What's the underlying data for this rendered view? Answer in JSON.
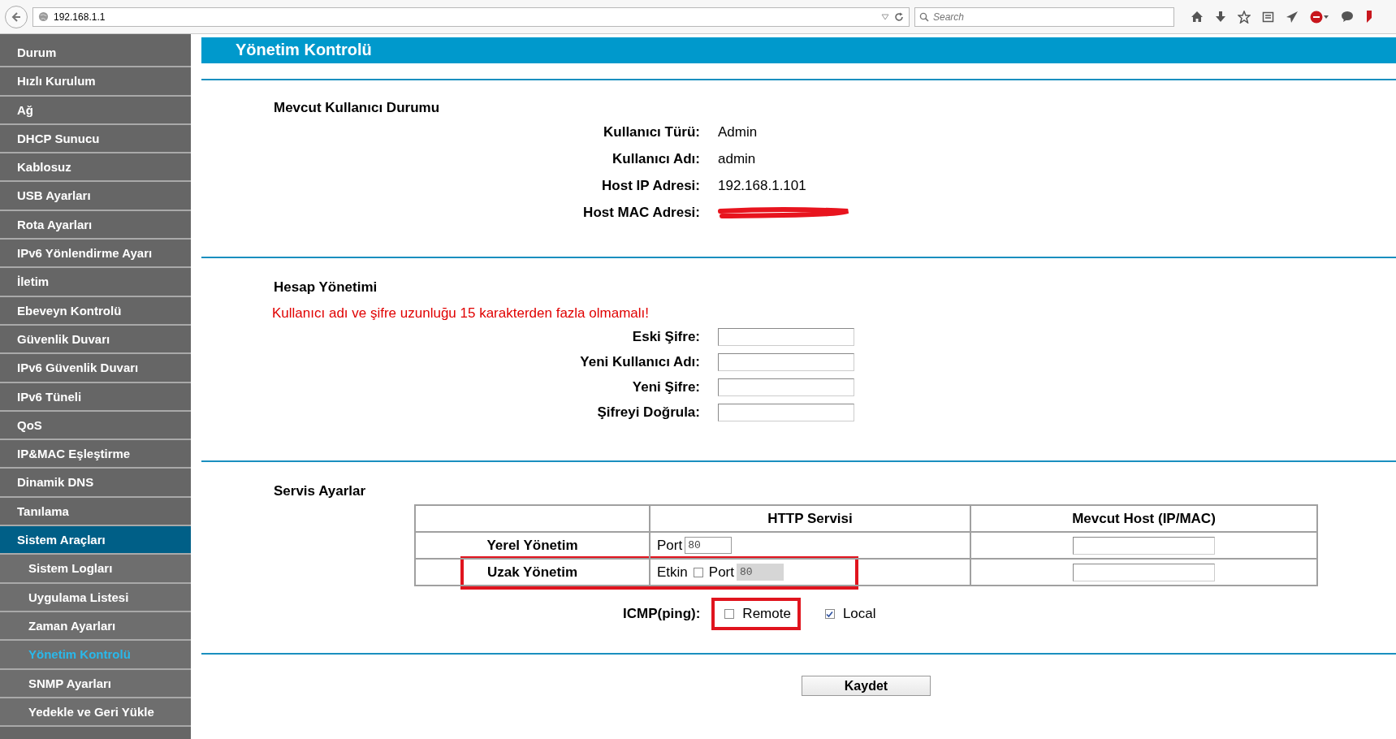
{
  "browser": {
    "url": "192.168.1.1",
    "search": {
      "placeholder": "Search"
    }
  },
  "sidebar": {
    "items": [
      {
        "label": "Durum",
        "selected": false
      },
      {
        "label": "Hızlı Kurulum",
        "selected": false
      },
      {
        "label": "Ağ",
        "selected": false
      },
      {
        "label": "DHCP Sunucu",
        "selected": false
      },
      {
        "label": "Kablosuz",
        "selected": false
      },
      {
        "label": "USB Ayarları",
        "selected": false
      },
      {
        "label": "Rota Ayarları",
        "selected": false
      },
      {
        "label": "IPv6 Yönlendirme Ayarı",
        "selected": false
      },
      {
        "label": "İletim",
        "selected": false
      },
      {
        "label": "Ebeveyn Kontrolü",
        "selected": false
      },
      {
        "label": "Güvenlik Duvarı",
        "selected": false
      },
      {
        "label": "IPv6 Güvenlik Duvarı",
        "selected": false
      },
      {
        "label": "IPv6 Tüneli",
        "selected": false
      },
      {
        "label": "QoS",
        "selected": false
      },
      {
        "label": "IP&MAC Eşleştirme",
        "selected": false
      },
      {
        "label": "Dinamik DNS",
        "selected": false
      },
      {
        "label": "Tanılama",
        "selected": false
      },
      {
        "label": "Sistem Araçları",
        "selected": true,
        "children": [
          {
            "label": "Sistem Logları",
            "selected": false
          },
          {
            "label": "Uygulama Listesi",
            "selected": false
          },
          {
            "label": "Zaman Ayarları",
            "selected": false
          },
          {
            "label": "Yönetim Kontrolü",
            "selected": true
          },
          {
            "label": "SNMP Ayarları",
            "selected": false
          },
          {
            "label": "Yedekle ve Geri Yükle",
            "selected": false
          }
        ]
      }
    ]
  },
  "page": {
    "title": "Yönetim Kontrolü",
    "user_status": {
      "title": "Mevcut Kullanıcı Durumu",
      "rows": [
        {
          "label": "Kullanıcı Türü:",
          "value": "Admin"
        },
        {
          "label": "Kullanıcı Adı:",
          "value": "admin"
        },
        {
          "label": "Host IP Adresi:",
          "value": "192.168.1.101"
        },
        {
          "label": "Host MAC Adresi:",
          "redacted": true
        }
      ]
    },
    "account": {
      "title": "Hesap Yönetimi",
      "warning": "Kullanıcı adı ve şifre uzunluğu 15 karakterden fazla olmamalı!",
      "fields": [
        {
          "label": "Eski Şifre:"
        },
        {
          "label": "Yeni Kullanıcı Adı:"
        },
        {
          "label": "Yeni Şifre:"
        },
        {
          "label": "Şifreyi Doğrula:"
        }
      ]
    },
    "service": {
      "title": "Servis Ayarlar",
      "columns": [
        {
          "label": "HTTP Servisi"
        },
        {
          "label": "Mevcut Host (IP/MAC)"
        }
      ],
      "rows": [
        {
          "label": "Yerel Yönetim",
          "port_label": "Port",
          "port": "80",
          "port_disabled": false,
          "highlighted": false
        },
        {
          "label": "Uzak Yönetim",
          "enable_label": "Etkin",
          "enabled": false,
          "port_label": "Port",
          "port": "80",
          "port_disabled": true,
          "highlighted": true
        }
      ],
      "icmp": {
        "label": "ICMP(ping):",
        "options": [
          {
            "label": "Remote",
            "checked": false,
            "highlighted": true
          },
          {
            "label": "Local",
            "checked": true,
            "highlighted": false
          }
        ]
      }
    },
    "save_button": "Kaydet"
  }
}
